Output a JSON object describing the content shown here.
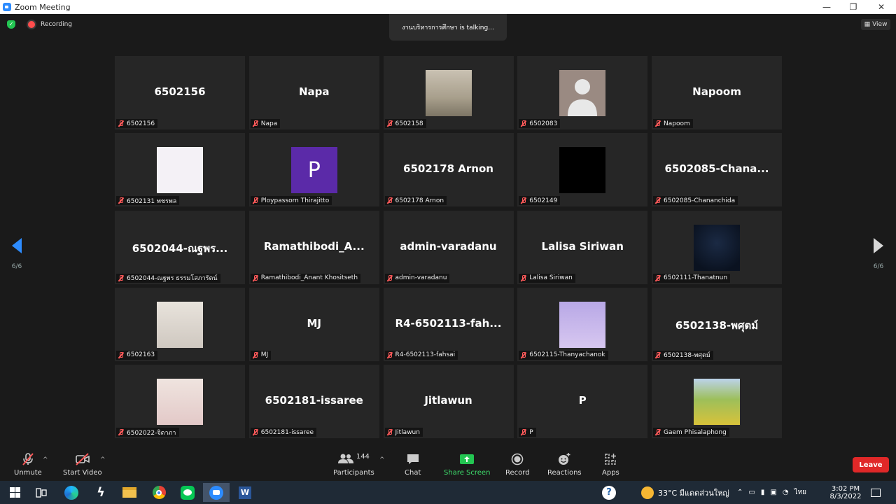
{
  "window": {
    "title": "Zoom Meeting",
    "minimize": "—",
    "maximize": "❐",
    "close": "✕"
  },
  "top": {
    "recording": "Recording",
    "talking": "งานบริหารการศึกษา is  talking...",
    "view": "View"
  },
  "pager": {
    "left": "6/6",
    "right": "6/6"
  },
  "tiles": [
    {
      "big": "6502156",
      "label": "6502156",
      "pic": ""
    },
    {
      "big": "Napa",
      "label": "Napa",
      "pic": ""
    },
    {
      "big": "",
      "label": "6502158",
      "pic": "room"
    },
    {
      "big": "",
      "label": "6502083",
      "pic": "avatar"
    },
    {
      "big": "Napoom",
      "label": "Napoom",
      "pic": ""
    },
    {
      "big": "",
      "label": "6502131 พชรพล",
      "pic": "unicorn"
    },
    {
      "big": "",
      "label": "Ploypassorn Thirajitto",
      "pic": "p"
    },
    {
      "big": "6502178 Arnon",
      "label": "6502178 Arnon",
      "pic": ""
    },
    {
      "big": "",
      "label": "6502149",
      "pic": "plain"
    },
    {
      "big": "6502085-Chana...",
      "label": "6502085-Chananchida",
      "pic": ""
    },
    {
      "big": "6502044-ณฐพร...",
      "label": "6502044-ณฐพร ธรรมโสภารัตน์",
      "pic": ""
    },
    {
      "big": "Ramathibodi_A...",
      "label": "Ramathibodi_Anant Khositseth",
      "pic": ""
    },
    {
      "big": "admin-varadanu",
      "label": "admin-varadanu",
      "pic": ""
    },
    {
      "big": "Lalisa Siriwan",
      "label": "Lalisa Siriwan",
      "pic": ""
    },
    {
      "big": "",
      "label": "6502111-Thanatnun",
      "pic": "night"
    },
    {
      "big": "",
      "label": "6502163",
      "pic": "mask"
    },
    {
      "big": "MJ",
      "label": "MJ",
      "pic": ""
    },
    {
      "big": "R4-6502113-fah...",
      "label": "R4-6502113-fahsai",
      "pic": ""
    },
    {
      "big": "",
      "label": "6502115-Thanyachanok",
      "pic": "cat"
    },
    {
      "big": "6502138-พศุตม์",
      "label": "6502138-พศุตม์",
      "pic": ""
    },
    {
      "big": "",
      "label": "6502022-จิดาภา",
      "pic": "girl"
    },
    {
      "big": "6502181-issaree",
      "label": "6502181-issaree",
      "pic": ""
    },
    {
      "big": "Jitlawun",
      "label": "Jitlawun",
      "pic": ""
    },
    {
      "big": "P",
      "label": "P",
      "pic": ""
    },
    {
      "big": "",
      "label": "Gaem Phisalaphong",
      "pic": "field"
    }
  ],
  "avatar_letter": "P",
  "toolbar": {
    "unmute": "Unmute",
    "start_video": "Start Video",
    "participants": "Participants",
    "participants_count": "144",
    "chat": "Chat",
    "share_screen": "Share Screen",
    "record": "Record",
    "reactions": "Reactions",
    "apps": "Apps",
    "leave": "Leave"
  },
  "taskbar": {
    "weather": "33°C  มีแดดส่วนใหญ่",
    "lang": "ไทย",
    "time": "3:02 PM",
    "date": "8/3/2022",
    "word_letter": "W"
  },
  "colors": {
    "accent": "#2d8cff",
    "share": "#23c552",
    "leave": "#e02828",
    "mute": "#ff5a5a"
  }
}
